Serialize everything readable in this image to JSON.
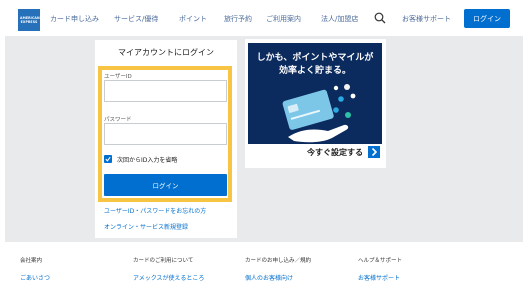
{
  "header": {
    "logo_line1": "AMERICAN",
    "logo_line2": "EXPRESS",
    "nav": [
      "カード申し込み",
      "サービス/優待",
      "ポイント",
      "旅行予約",
      "ご利用案内",
      "法人/加盟店"
    ],
    "support": "お客様サポート",
    "login": "ログイン"
  },
  "login": {
    "title": "マイアカウントにログイン",
    "userid_label": "ユーザーID",
    "password_label": "パスワード",
    "remember_label": "次回からID入力を省略",
    "remember_checked": true,
    "submit": "ログイン",
    "forgot_link": "ユーザーID・パスワードをお忘れの方",
    "register_link": "オンライン・サービス新規登録"
  },
  "promo": {
    "line1": "しかも、ポイントやマイルが",
    "line2": "効率よく貯まる。",
    "cta": "今すぐ設定する"
  },
  "footer": {
    "columns": [
      {
        "heading": "会社案内",
        "link": "ごあいさつ"
      },
      {
        "heading": "カードのご利用について",
        "link": "アメックスが使えるところ"
      },
      {
        "heading": "カードのお申し込み／規約",
        "link": "個人のお客様向け"
      },
      {
        "heading": "ヘルプ＆サポート",
        "link": "お客様サポート"
      }
    ]
  },
  "colors": {
    "brand_blue": "#006fcf",
    "highlight_yellow": "#f7c443",
    "promo_navy": "#0b2a5e"
  }
}
